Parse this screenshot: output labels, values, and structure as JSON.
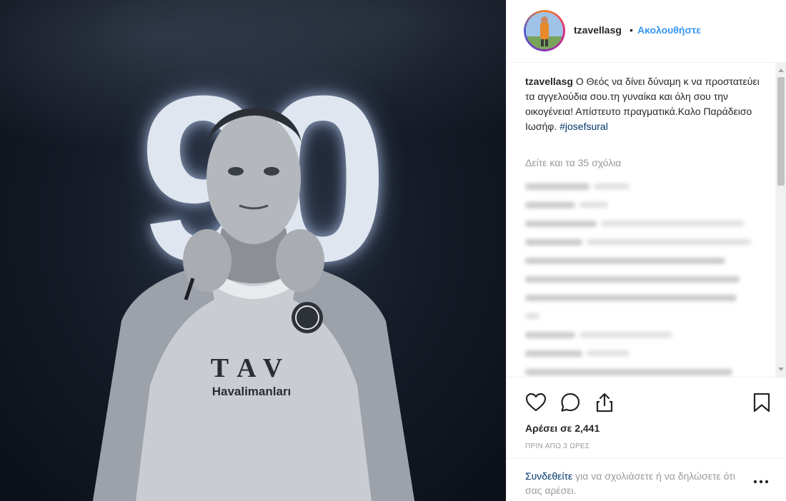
{
  "photo": {
    "number": "90",
    "shirt_brand": "TAV",
    "shirt_sub": "Havalimanları"
  },
  "header": {
    "username": "tzavellasg",
    "separator": "•",
    "follow_label": "Ακολουθήστε"
  },
  "caption": {
    "username": "tzavellasg",
    "text": "Ο Θεός να δίνει δύναμη κ να προστατεύει τα αγγελούδια σου.τη γυναίκα και όλη σου την οικογένεια! Απίστευτο πραγματικά.Καλο Παράδεισο Ιωσήφ.",
    "hashtag": "#josefsural"
  },
  "view_all_comments": "Δείτε και τα 35 σχόλια",
  "actions": {
    "like_icon": "heart-icon",
    "comment_icon": "comment-icon",
    "share_icon": "share-icon",
    "save_icon": "bookmark-icon"
  },
  "likes": "Αρέσει σε 2,441",
  "timestamp": "ΠΡΙΝ ΑΠΟ 3 ΩΡΕΣ",
  "login": {
    "link": "Συνδεθείτε",
    "text": " για να σχολιάσετε ή να δηλώσετε ότι σας αρέσει."
  },
  "colors": {
    "accent_blue": "#3897f0",
    "link_dark": "#003569",
    "muted": "#999999",
    "text": "#262626"
  }
}
